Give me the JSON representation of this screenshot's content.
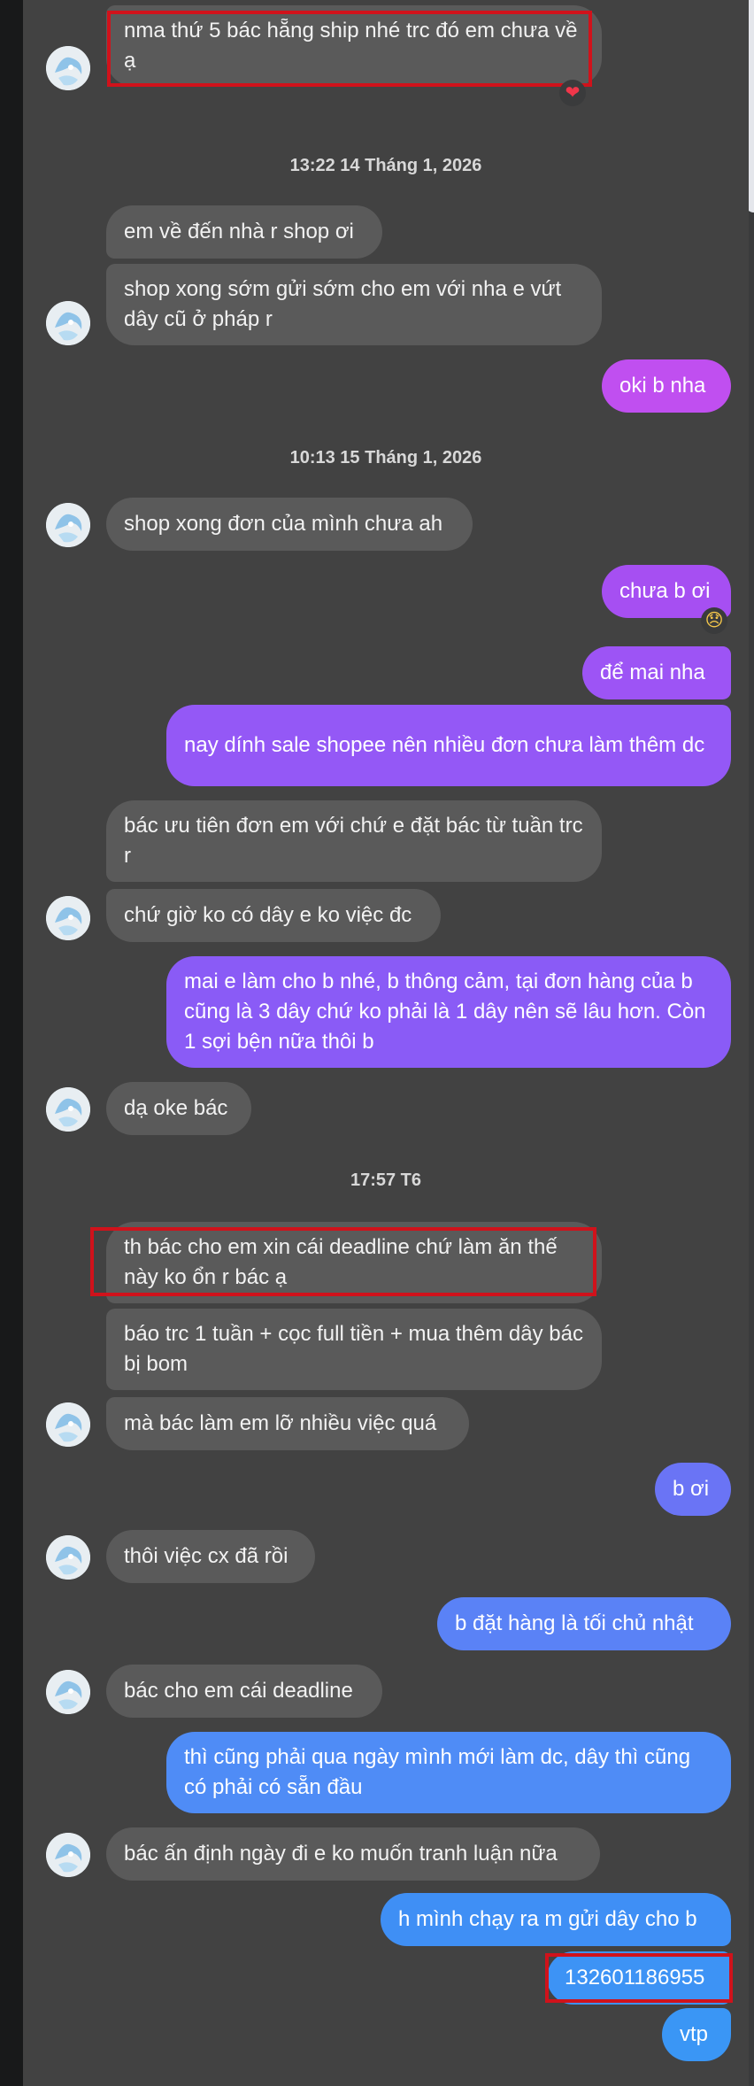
{
  "colors": {
    "incoming_bubble": "#5a5a5a",
    "outgoing_purple": "#9b59f5",
    "outgoing_blue": "#4c8df6",
    "highlight": "#d0121b"
  },
  "messages": {
    "m1": "nma thứ 5 bác hẵng ship nhé trc đó em chưa về ạ",
    "ts1": "13:22 14 Tháng 1, 2026",
    "m2": "em về đến nhà r shop ơi",
    "m3": "shop xong sớm gửi sớm cho em với nha e vứt dây cũ ở pháp r",
    "m4": "oki b nha",
    "ts2": "10:13 15 Tháng 1, 2026",
    "m5": "shop xong đơn của mình chưa ah",
    "m6": "chưa b ơi",
    "m7": "để mai nha",
    "m8": "nay dính sale shopee nên nhiều đơn chưa làm thêm dc",
    "m9": "bác ưu tiên đơn em với chứ e đặt bác từ tuần trc r",
    "m10": "chứ giờ ko có dây e ko việc đc",
    "m11": "mai e làm cho b nhé, b thông cảm, tại đơn hàng của b cũng là 3 dây chứ ko phải là 1 dây nên sẽ lâu hơn. Còn 1 sợi bện nữa thôi b",
    "m12": "dạ oke bác",
    "ts3": "17:57 T6",
    "m13": "th bác cho em xin cái deadline chứ làm ăn thế này ko ổn r bác ạ",
    "m14": "báo trc 1 tuần + cọc full tiền + mua thêm dây bác bị bom",
    "m15": "mà bác làm em lỡ nhiều việc quá",
    "m16": "b ơi",
    "m17": "thôi việc cx đã rồi",
    "m18": "b đặt hàng là tối chủ nhật",
    "m19": "bác cho em cái deadline",
    "m20": "thì cũng phải qua ngày mình mới làm dc, dây thì cũng có phải có sẵn đầu",
    "m21": "bác ấn định ngày đi e ko muốn tranh luận nữa",
    "m22": "h mình chạy ra m gửi dây cho b",
    "m23": "132601186955",
    "m24": "vtp"
  },
  "reactions": {
    "heart": "❤",
    "sad": "😞"
  },
  "icons": {
    "avatar": "contact-avatar",
    "reaction_heart": "heart-reaction-icon",
    "reaction_sad": "sad-reaction-icon"
  }
}
